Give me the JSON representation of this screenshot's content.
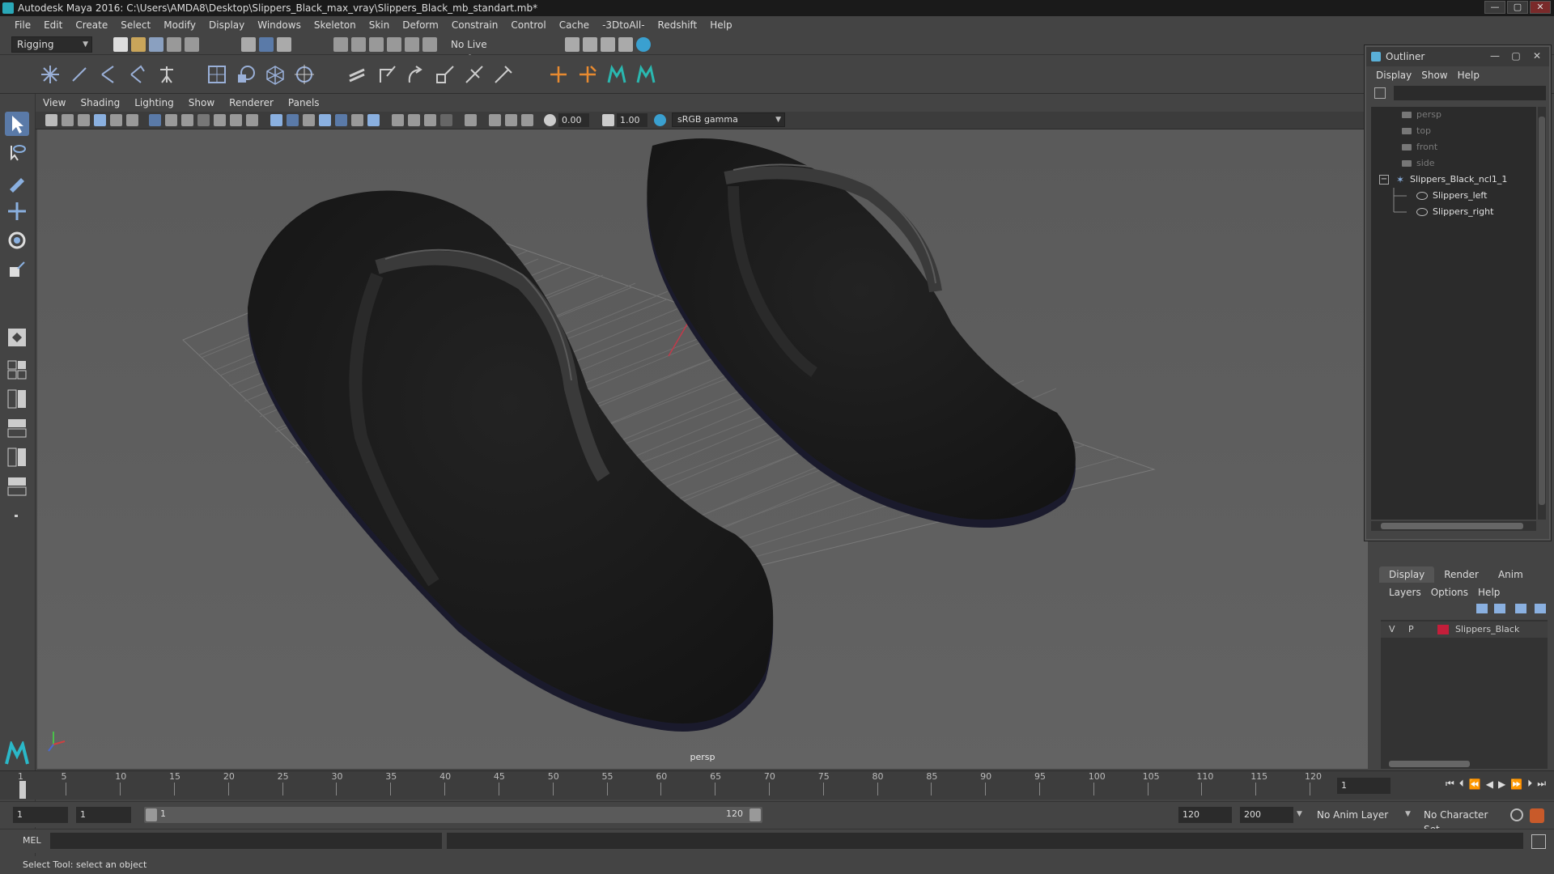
{
  "window": {
    "title": "Autodesk Maya 2016: C:\\Users\\AMDA8\\Desktop\\Slippers_Black_max_vray\\Slippers_Black_mb_standart.mb*",
    "min_label": "—",
    "max_label": "▢",
    "close_label": "✕"
  },
  "menubar": [
    "File",
    "Edit",
    "Create",
    "Select",
    "Modify",
    "Display",
    "Windows",
    "Skeleton",
    "Skin",
    "Deform",
    "Constrain",
    "Control",
    "Cache",
    "-3DtoAll-",
    "Redshift",
    "Help"
  ],
  "statusline": {
    "mode": "Rigging",
    "live_surface": "No Live Surface"
  },
  "panel": {
    "menus": [
      "View",
      "Shading",
      "Lighting",
      "Show",
      "Renderer",
      "Panels"
    ],
    "near_clip": "0.00",
    "far_clip": "1.00",
    "color_space": "sRGB gamma",
    "camera_label": "persp"
  },
  "outliner": {
    "title": "Outliner",
    "menus": [
      "Display",
      "Show",
      "Help"
    ],
    "items": [
      {
        "label": "persp",
        "kind": "camera"
      },
      {
        "label": "top",
        "kind": "camera"
      },
      {
        "label": "front",
        "kind": "camera"
      },
      {
        "label": "side",
        "kind": "camera"
      },
      {
        "label": "Slippers_Black_ncl1_1",
        "kind": "group",
        "expander": "−"
      },
      {
        "label": "Slippers_left",
        "kind": "mesh"
      },
      {
        "label": "Slippers_right",
        "kind": "mesh"
      }
    ]
  },
  "layers": {
    "tabs": [
      "Display",
      "Render",
      "Anim"
    ],
    "menus": [
      "Layers",
      "Options",
      "Help"
    ],
    "rows": [
      {
        "v": "V",
        "p": "P",
        "name": "Slippers_Black",
        "color": "#c41e3a"
      }
    ]
  },
  "timeline": {
    "ticks": [
      "1",
      "5",
      "10",
      "15",
      "20",
      "25",
      "30",
      "35",
      "40",
      "45",
      "50",
      "55",
      "60",
      "65",
      "70",
      "75",
      "80",
      "85",
      "90",
      "95",
      "100",
      "105",
      "110",
      "115",
      "120"
    ],
    "current_frame": "1"
  },
  "range": {
    "start": "1",
    "playback_start": "1",
    "slider_start": "1",
    "slider_end": "120",
    "playback_end": "120",
    "end": "200",
    "anim_layer": "No Anim Layer",
    "char_set": "No Character Set"
  },
  "cmdline": {
    "lang": "MEL"
  },
  "helpline": "Select Tool: select an object",
  "colors": {
    "accent": "#5a7aa8",
    "viewport_bg": "#5e5e5e",
    "grid": "#6e6e6e",
    "layer_color": "#c41e3a"
  }
}
